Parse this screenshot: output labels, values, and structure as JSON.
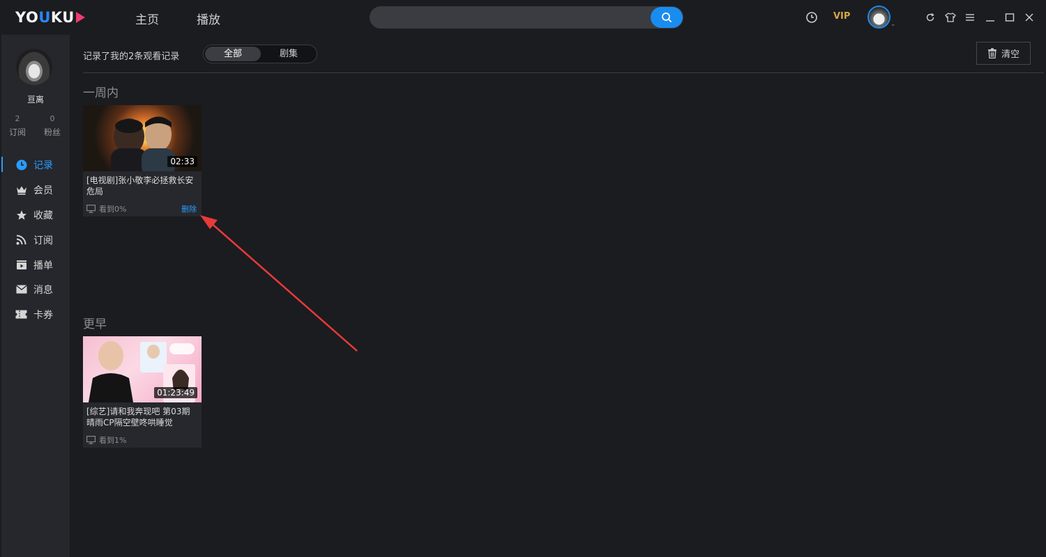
{
  "app": {
    "logo_text_1": "YO",
    "logo_text_2": "U",
    "logo_text_3": "KU",
    "nav_tabs": [
      "主页",
      "播放"
    ],
    "search": {
      "value": "",
      "placeholder": ""
    },
    "vip_label": "VIP",
    "accent_color": "#1a8cf0"
  },
  "sidebar": {
    "username": "亘离",
    "stats": [
      {
        "count": "2",
        "label": "订阅"
      },
      {
        "count": "0",
        "label": "粉丝"
      }
    ],
    "items": [
      {
        "label": "记录",
        "icon": "clock-icon",
        "active": true
      },
      {
        "label": "会员",
        "icon": "crown-icon"
      },
      {
        "label": "收藏",
        "icon": "star-icon"
      },
      {
        "label": "订阅",
        "icon": "rss-icon"
      },
      {
        "label": "播单",
        "icon": "playlist-icon"
      },
      {
        "label": "消息",
        "icon": "mail-icon"
      },
      {
        "label": "卡券",
        "icon": "ticket-icon"
      }
    ]
  },
  "main": {
    "summary": "记录了我的2条观看记录",
    "filters": [
      "全部",
      "剧集"
    ],
    "active_filter": "全部",
    "clear_label": "清空",
    "sections": [
      {
        "title": "一周内",
        "cards": [
          {
            "duration": "02:33",
            "title": "[电视剧]张小敬李必拯救长安危局",
            "progress": "看到0%",
            "delete_label": "删除"
          }
        ]
      },
      {
        "title": "更早",
        "cards": [
          {
            "duration": "01:23:49",
            "title": "[综艺]请和我奔现吧 第03期 晴雨CP隔空壁咚哄睡觉",
            "progress": "看到1%"
          }
        ]
      }
    ]
  }
}
